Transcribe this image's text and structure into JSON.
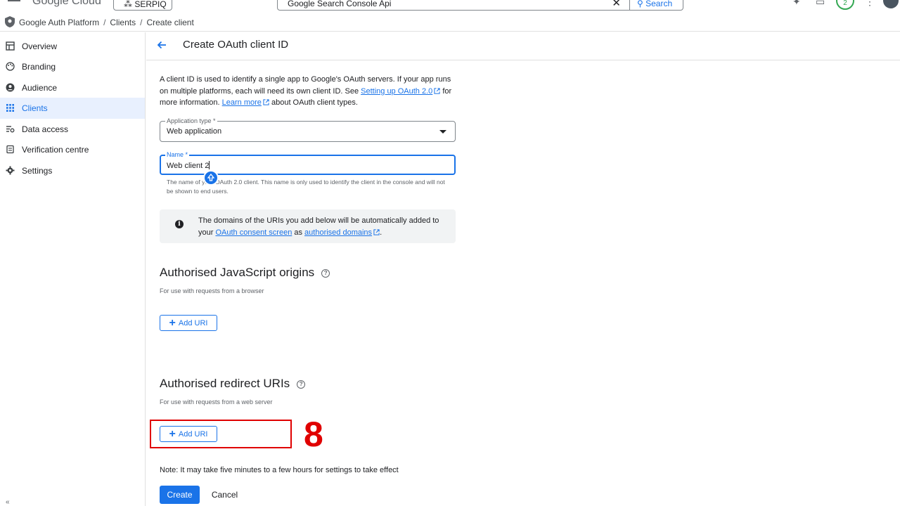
{
  "topbar": {
    "logo": "Google Cloud",
    "project": "SERPIQ",
    "search_value": "Google Search Console Api",
    "search_button": "Search",
    "notification_count": "2"
  },
  "breadcrumb": {
    "items": [
      "Google Auth Platform",
      "Clients",
      "Create client"
    ]
  },
  "sidebar": {
    "items": [
      {
        "label": "Overview",
        "icon": "dashboard-icon"
      },
      {
        "label": "Branding",
        "icon": "palette-icon"
      },
      {
        "label": "Audience",
        "icon": "account-circle-icon"
      },
      {
        "label": "Clients",
        "icon": "apps-grid-icon",
        "active": true
      },
      {
        "label": "Data access",
        "icon": "data-access-icon"
      },
      {
        "label": "Verification centre",
        "icon": "verification-icon"
      },
      {
        "label": "Settings",
        "icon": "gear-icon"
      }
    ]
  },
  "page": {
    "title": "Create OAuth client ID",
    "intro_1": "A client ID is used to identify a single app to Google's OAuth servers. If your app runs on multiple platforms, each will need its own client ID. See ",
    "intro_link_1": "Setting up OAuth 2.0",
    "intro_2": " for more information. ",
    "intro_link_2": "Learn more",
    "intro_3": " about OAuth client types."
  },
  "form": {
    "app_type_label": "Application type *",
    "app_type_value": "Web application",
    "name_label": "Name *",
    "name_value": "Web client 2",
    "name_helper": "The name of your OAuth 2.0 client. This name is only used to identify the client in the console and will not be shown to end users."
  },
  "info": {
    "text_1": "The domains of the URIs you add below will be automatically added to your ",
    "link_1": "OAuth consent screen",
    "text_2": " as ",
    "link_2": "authorised domains",
    "text_3": "."
  },
  "js_origins": {
    "title": "Authorised JavaScript origins",
    "subtitle": "For use with requests from a browser",
    "button": "Add URI"
  },
  "redirect_uris": {
    "title": "Authorised redirect URIs",
    "subtitle": "For use with requests from a web server",
    "button": "Add URI"
  },
  "annotation": {
    "step": "8",
    "color": "#e00000"
  },
  "footer": {
    "note": "Note: It may take five minutes to a few hours for settings to take effect",
    "create": "Create",
    "cancel": "Cancel"
  },
  "colors": {
    "accent": "#1a73e8",
    "active_bg": "#e8f0fe"
  }
}
